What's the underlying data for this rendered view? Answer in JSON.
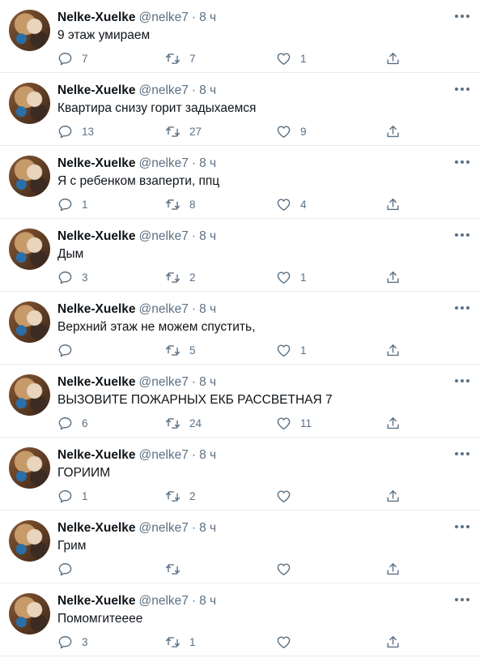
{
  "author": {
    "name": "Nelke-Xuelke",
    "handle": "@nelke7",
    "separator": "·"
  },
  "icons": {
    "avatar": "profile-photo",
    "more": "more-dots-icon",
    "reply": "reply-icon",
    "retweet": "retweet-icon",
    "like": "heart-icon",
    "share": "share-icon"
  },
  "colors": {
    "secondary_text": "#5b7083",
    "primary_text": "#0f1419",
    "divider": "#e6ecf0"
  },
  "tweets": [
    {
      "time": "8 ч",
      "text": "9 этаж умираем",
      "replies": "7",
      "retweets": "7",
      "likes": "1"
    },
    {
      "time": "8 ч",
      "text": "Квартира снизу горит задыхаемся",
      "replies": "13",
      "retweets": "27",
      "likes": "9"
    },
    {
      "time": "8 ч",
      "text": "Я с ребенком взаперти, ппц",
      "replies": "1",
      "retweets": "8",
      "likes": "4"
    },
    {
      "time": "8 ч",
      "text": "Дым",
      "replies": "3",
      "retweets": "2",
      "likes": "1"
    },
    {
      "time": "8 ч",
      "text": "Верхний этаж не можем спустить,",
      "replies": "",
      "retweets": "5",
      "likes": "1"
    },
    {
      "time": "8 ч",
      "text": "ВЫЗОВИТЕ ПОЖАРНЫХ ЕКБ РАССВЕТНАЯ 7",
      "replies": "6",
      "retweets": "24",
      "likes": "11"
    },
    {
      "time": "8 ч",
      "text": "ГОРИИМ",
      "replies": "1",
      "retweets": "2",
      "likes": ""
    },
    {
      "time": "8 ч",
      "text": "Грим",
      "replies": "",
      "retweets": "",
      "likes": ""
    },
    {
      "time": "8 ч",
      "text": "Помомгитееее",
      "replies": "3",
      "retweets": "1",
      "likes": ""
    }
  ]
}
